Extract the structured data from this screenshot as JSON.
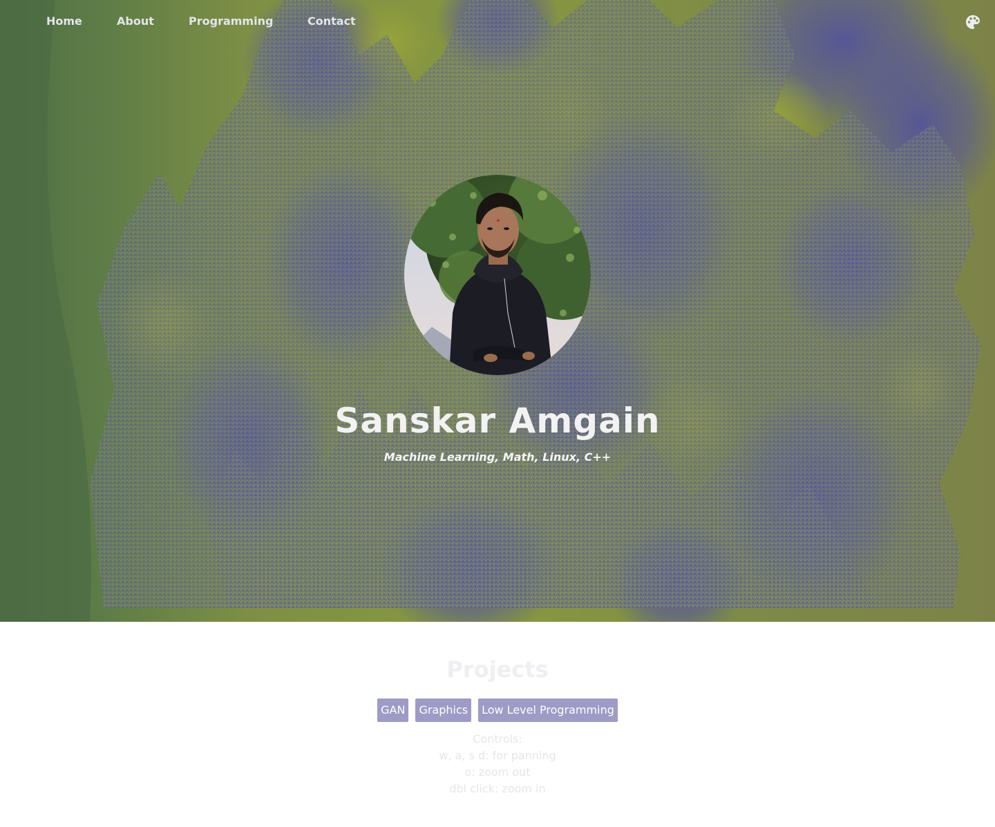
{
  "nav": {
    "links": [
      "Home",
      "About",
      "Programming",
      "Contact"
    ],
    "theme_icon": "palette-icon"
  },
  "hero": {
    "name": "Sanskar Amgain",
    "tagline": "Machine Learning, Math, Linux, C++",
    "avatar_icon": "profile-photo",
    "colors": {
      "green": "#5b7a4a",
      "olive": "#8a9a3e",
      "purple": "#5a5a96"
    }
  },
  "projects": {
    "title": "Projects",
    "tags": [
      "GAN",
      "Graphics",
      "Low Level Programming"
    ],
    "tag_color": "#9e9bc6",
    "controls": [
      "Controls:",
      "w, a, s d: for panning",
      "o: zoom out",
      "dbl click: zoom in"
    ]
  }
}
